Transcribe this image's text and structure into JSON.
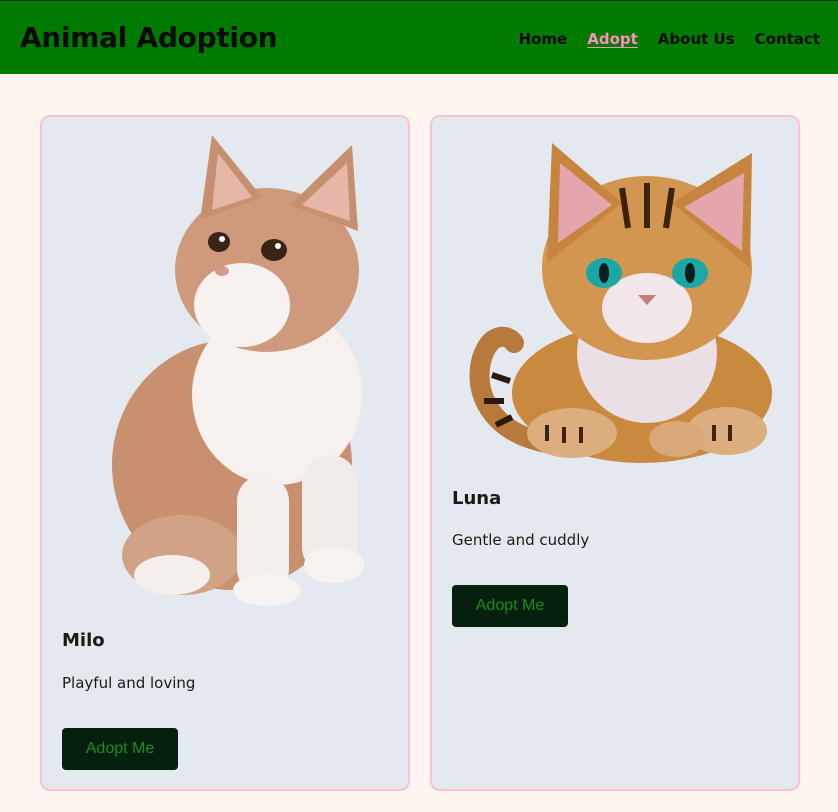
{
  "header": {
    "title": "Animal Adoption",
    "nav": [
      {
        "label": "Home",
        "active": false
      },
      {
        "label": "Adopt",
        "active": true
      },
      {
        "label": "About Us",
        "active": false
      },
      {
        "label": "Contact",
        "active": false
      }
    ]
  },
  "pets": [
    {
      "name": "Milo",
      "description": "Playful and loving",
      "button_label": "Adopt Me",
      "image": "white-and-ginger-kitten-photo"
    },
    {
      "name": "Luna",
      "description": "Gentle and cuddly",
      "button_label": "Adopt Me",
      "image": "tabby-kitten-illustration"
    }
  ],
  "colors": {
    "header_bg": "#007a00",
    "page_bg": "#fff5f0",
    "card_bg": "#e3e9ee",
    "card_border": "#ffc0cf",
    "active_nav": "#ff8fb8",
    "button_bg": "#062010",
    "button_text": "#1d8a1d"
  }
}
